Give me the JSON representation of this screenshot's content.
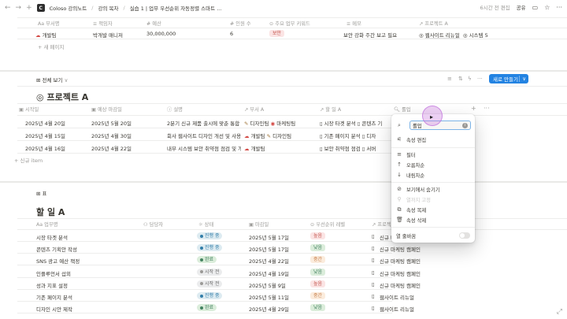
{
  "topbar": {
    "crumbs": [
      "Coloso 강의노트",
      "강의 목차",
      "실습 1 | 업무 우선순위 자동정렬 스마트 ..."
    ],
    "edited": "6시간 전 편집",
    "share": "공유"
  },
  "top_table": {
    "headers": [
      "부서명",
      "책임자",
      "예산",
      "인원 수",
      "주요 업무 키워드",
      "메모",
      "프로젝트 A"
    ],
    "row": {
      "dept": "개발팀",
      "manager": "박개발 매니저",
      "budget": "30,000,000",
      "people": "6",
      "keyword": "보안",
      "memo": "보안 강화 주간 보고 필요",
      "project": [
        "웹사이트 리뉴얼",
        "시스템 5"
      ]
    },
    "new_page": "+ 새 페이지"
  },
  "view_tab": {
    "label": "전체 보기",
    "new_button": "새로 만들기"
  },
  "project_a": {
    "title": "프로젝트 A",
    "headers": [
      "시작일",
      "예상 마감일",
      "설명",
      "부서 A",
      "할 일 A",
      "롤업"
    ],
    "rows": [
      {
        "start": "2025년 4월 20일",
        "end": "2025년 5월 20일",
        "desc": "2분기 신규 제품 출시에 맞춘 통합 마",
        "dept": [
          "디자인팀",
          "마케팅팀"
        ],
        "tasks": [
          "시장 타겟 분석",
          "콘텐츠 기"
        ]
      },
      {
        "start": "2025년 4월 15일",
        "end": "2025년 4월 30일",
        "desc": "회사 웹사이트 디자인 개선 및 사용자",
        "dept": [
          "개발팀",
          "디자인팀"
        ],
        "tasks": [
          "기존 페이지 분석",
          "디자"
        ]
      },
      {
        "start": "2025년 4월 16일",
        "end": "2025년 4월 22일",
        "desc": "내부 시스템 보안 취약점 점검 및 개",
        "dept": [
          "개발팀"
        ],
        "tasks": [
          "보안 취약점 점검",
          "서버"
        ]
      }
    ],
    "new_item": "+ 신규 item"
  },
  "table_tab": {
    "label": "표"
  },
  "tasks_a": {
    "title": "할 일 A",
    "headers": [
      "업무명",
      "담당자",
      "상태",
      "마감일",
      "우선순위 레벨",
      "프로젝트 A"
    ],
    "rows": [
      {
        "name": "시장 타겟 분석",
        "status": "진행 중",
        "status_color": "blue",
        "due": "2025년 5월 17일",
        "priority": "높음",
        "priority_color": "red",
        "project": "신규 마케팅 캠페인"
      },
      {
        "name": "콘텐츠 기획안 작성",
        "status": "진행 중",
        "status_color": "blue",
        "due": "2025년 5월 17일",
        "priority": "낮음",
        "priority_color": "green",
        "project": "신규 마케팅 캠페인"
      },
      {
        "name": "SNS 광고 예산 책정",
        "status": "완료",
        "status_color": "green",
        "due": "2025년 4월 22일",
        "priority": "중간",
        "priority_color": "orange",
        "project": "신규 마케팅 캠페인"
      },
      {
        "name": "인플루언서 섭외",
        "status": "시작 전",
        "status_color": "gray",
        "due": "2025년 4월 19일",
        "priority": "낮음",
        "priority_color": "green",
        "project": "신규 마케팅 캠페인"
      },
      {
        "name": "성과 지표 설정",
        "status": "시작 전",
        "status_color": "gray",
        "due": "2025년 5월 9일",
        "priority": "높음",
        "priority_color": "red",
        "project": "신규 마케팅 캠페인"
      },
      {
        "name": "기존 페이지 분석",
        "status": "진행 중",
        "status_color": "blue",
        "due": "2025년 5월 11일",
        "priority": "중간",
        "priority_color": "orange",
        "project": "웹사이트 리뉴얼"
      },
      {
        "name": "디자인 시안 제작",
        "status": "완료",
        "status_color": "green",
        "due": "2025년 4월 29일",
        "priority": "낮음",
        "priority_color": "green",
        "project": "웹사이트 리뉴얼"
      }
    ]
  },
  "menu": {
    "search_value": "롤업",
    "items": {
      "edit": "속성 편집",
      "filter": "필터",
      "asc": "오름차순",
      "desc": "내림차순",
      "hide": "보기에서 숨기기",
      "freeze": "열까지 고정",
      "duplicate": "속성 복제",
      "delete": "속성 삭제",
      "wrap": "열 줄바꿈"
    }
  }
}
